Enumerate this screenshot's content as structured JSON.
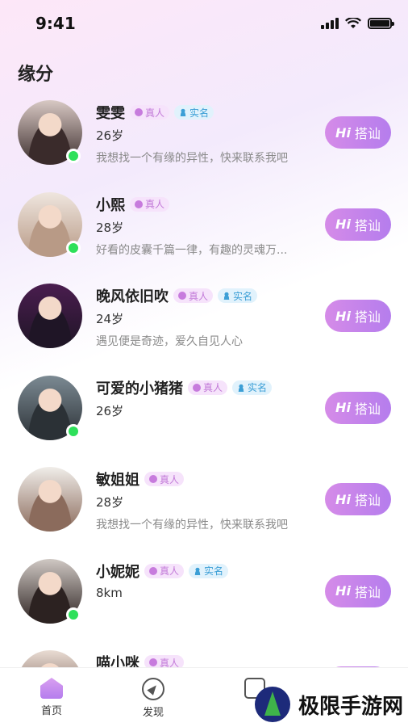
{
  "status_bar": {
    "time": "9:41"
  },
  "page": {
    "title": "缘分"
  },
  "badges": {
    "real": "真人",
    "verified": "实名"
  },
  "hi_button": {
    "hi": "Hi",
    "label": "搭讪"
  },
  "users": [
    {
      "name": "雯雯",
      "real": true,
      "verified": true,
      "age": "26岁",
      "bio": "我想找一个有缘的异性，快来联系我吧",
      "online": true,
      "avatar_colors": [
        "#d8c9c4",
        "#3a2b2b"
      ]
    },
    {
      "name": "小熙",
      "real": true,
      "verified": false,
      "age": "28岁",
      "bio": "好看的皮囊千篇一律，有趣的灵魂万...",
      "online": true,
      "avatar_colors": [
        "#efe6df",
        "#b89a86"
      ]
    },
    {
      "name": "晚风依旧吹",
      "real": true,
      "verified": true,
      "age": "24岁",
      "bio": "遇见便是奇迹，爱久自见人心",
      "online": false,
      "avatar_colors": [
        "#4a1d4f",
        "#1f1526"
      ]
    },
    {
      "name": "可爱的小猪猪",
      "real": true,
      "verified": true,
      "age": "26岁",
      "bio": "",
      "online": true,
      "avatar_colors": [
        "#7c8a93",
        "#2b3136"
      ]
    },
    {
      "name": "敏姐姐",
      "real": true,
      "verified": false,
      "age": "28岁",
      "bio": "我想找一个有缘的异性，快来联系我吧",
      "online": false,
      "avatar_colors": [
        "#f0ede9",
        "#8b6b5c"
      ]
    },
    {
      "name": "小妮妮",
      "real": true,
      "verified": true,
      "age": "8km",
      "bio": "",
      "online": true,
      "avatar_colors": [
        "#cfc8c3",
        "#2c2221"
      ]
    },
    {
      "name": "喵小咪",
      "real": true,
      "verified": false,
      "age": "",
      "bio": "",
      "online": false,
      "avatar_colors": [
        "#e9dcd3",
        "#5a3d33"
      ]
    }
  ],
  "tabbar": {
    "home": "首页",
    "discover": "发现"
  },
  "watermark": {
    "text": "极限手游网"
  }
}
